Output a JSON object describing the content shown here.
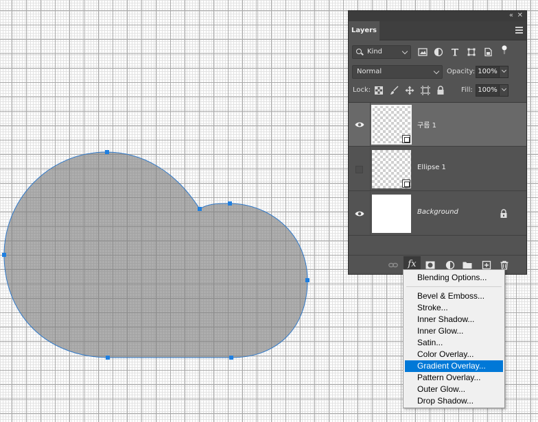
{
  "panel": {
    "collapse_glyph": "«",
    "close_glyph": "✕",
    "tab_label": "Layers",
    "menu_icon": "hamburger-icon"
  },
  "filter": {
    "kind_label": "Kind",
    "icons": [
      "image-filter-icon",
      "adjustment-filter-icon",
      "type-filter-icon",
      "shape-filter-icon",
      "smart-object-filter-icon",
      "filter-toggle-icon"
    ]
  },
  "blend": {
    "mode": "Normal",
    "opacity_label": "Opacity:",
    "opacity_value": "100%"
  },
  "lock": {
    "label": "Lock:",
    "fill_label": "Fill:",
    "fill_value": "100%"
  },
  "layers": [
    {
      "name": "구름 1",
      "visible": true,
      "selected": true,
      "type": "shape"
    },
    {
      "name": "Ellipse 1",
      "visible": false,
      "selected": false,
      "type": "shape"
    },
    {
      "name": "Background",
      "visible": true,
      "selected": false,
      "type": "background",
      "locked": true
    }
  ],
  "footer": {
    "fx_label": "fx",
    "icons": [
      "link-layers-icon",
      "fx-icon",
      "layer-mask-icon",
      "adjustment-layer-icon",
      "new-group-icon",
      "new-layer-icon",
      "delete-layer-icon"
    ]
  },
  "context_menu": {
    "items": [
      "Blending Options...",
      "Bevel & Emboss...",
      "Stroke...",
      "Inner Shadow...",
      "Inner Glow...",
      "Satin...",
      "Color Overlay...",
      "Gradient Overlay...",
      "Pattern Overlay...",
      "Outer Glow...",
      "Drop Shadow..."
    ],
    "highlighted": "Gradient Overlay...",
    "highlight_color": "#0078d7"
  },
  "colors": {
    "shape_fill": "#a6a6a6",
    "path_stroke": "#2f78c8",
    "panel_bg": "#535353"
  }
}
